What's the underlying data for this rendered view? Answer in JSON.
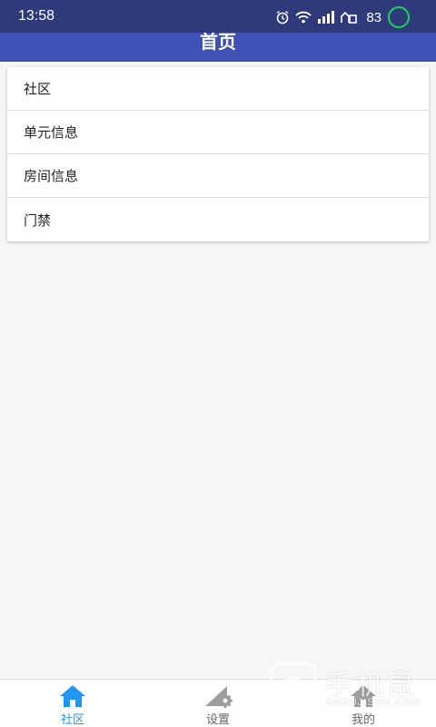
{
  "status_bar": {
    "time": "13:58",
    "battery": "83",
    "icons": [
      "alarm-icon",
      "wifi-icon",
      "signal-icon",
      "hd-signal-icon",
      "battery-ring-icon"
    ],
    "battery_ring_color": "#22c55e"
  },
  "header": {
    "title": "首页",
    "background": "#3f51b5"
  },
  "menu": {
    "items": [
      {
        "label": "社区"
      },
      {
        "label": "单元信息"
      },
      {
        "label": "房间信息"
      },
      {
        "label": "门禁"
      }
    ]
  },
  "bottom_nav": {
    "active_color": "#2196f3",
    "items": [
      {
        "label": "社区",
        "icon": "home-icon",
        "active": true
      },
      {
        "label": "设置",
        "icon": "settings-icon",
        "active": false
      },
      {
        "label": "我的",
        "icon": "home-icon",
        "active": false
      }
    ]
  },
  "watermark": {
    "title": "手机鼠",
    "subtitle": "SHOUJISHU.COM"
  }
}
